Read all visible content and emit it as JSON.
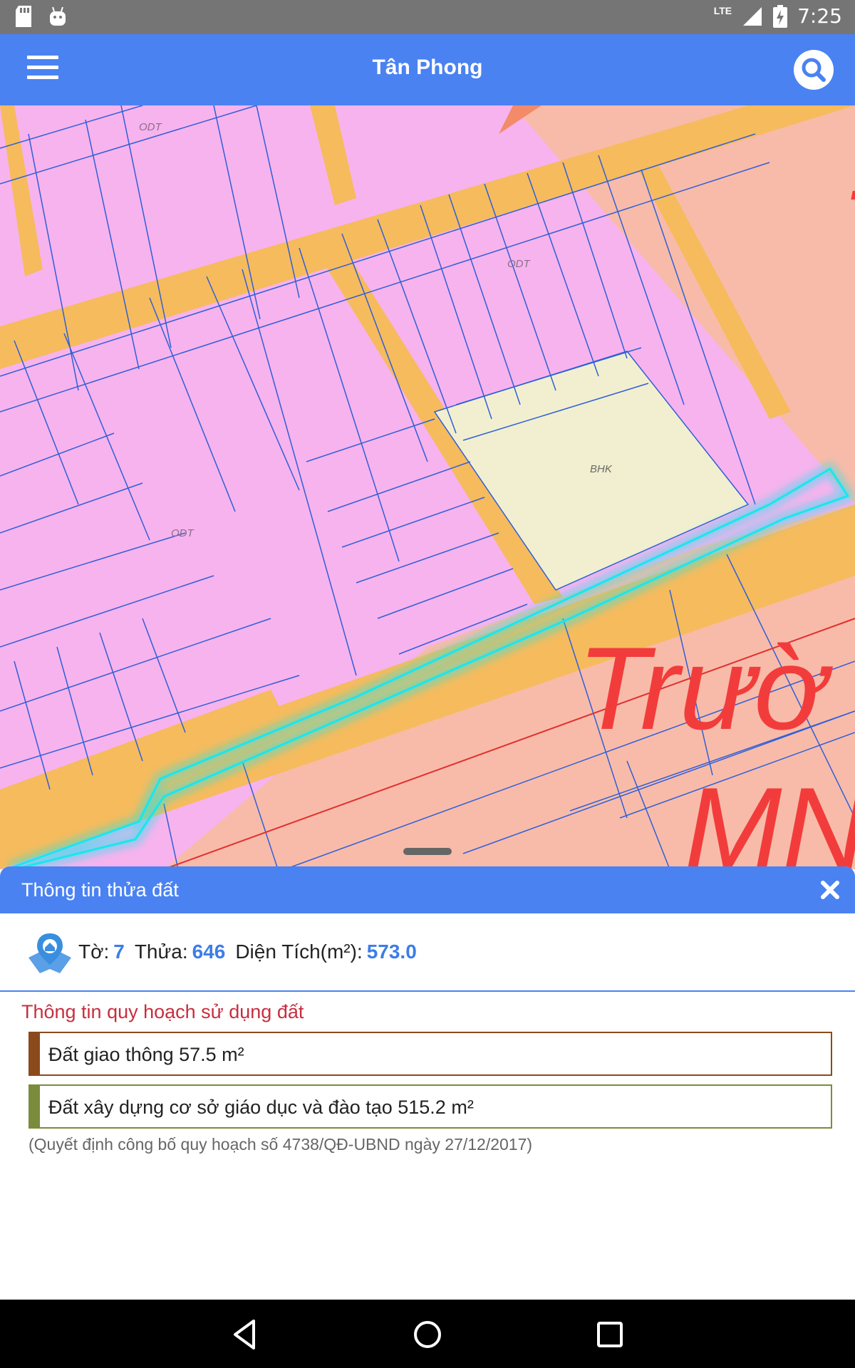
{
  "status_bar": {
    "time": "7:25",
    "network": "LTE",
    "icons": [
      "sd-card-icon",
      "android-debug-icon",
      "signal-icon",
      "battery-charging-icon"
    ]
  },
  "app_bar": {
    "title": "Tân Phong",
    "menu_icon": "hamburger-menu-icon",
    "search_icon": "search-icon",
    "color": "#4a82f2"
  },
  "map": {
    "labels": [
      "ODT",
      "ODT",
      "ODT",
      "BHK"
    ],
    "overlay_text": [
      "Trườ",
      "MN"
    ],
    "colors": {
      "residential": "#f7b3ed",
      "road": "#f6bb5d",
      "school": "#f8bba9",
      "other": "#f2efd0",
      "parcel_border": "#2f5fd8",
      "highlight": "#19e6ef"
    }
  },
  "sheet": {
    "title": "Thông tin thửa đất",
    "close_icon": "close-icon",
    "parcel": {
      "icon": "map-location-icon",
      "to_label": "Tờ:",
      "to_value": "7",
      "thua_label": "Thửa:",
      "thua_value": "646",
      "area_label": "Diện Tích(m²):",
      "area_value": "573.0"
    },
    "plan_heading": "Thông tin quy hoạch sử dụng đất",
    "plan_items": [
      {
        "text": "Đất giao thông 57.5 m²",
        "color": "#8b4a1c"
      },
      {
        "text": "Đất xây dựng cơ sở giáo dục và đào tạo 515.2 m²",
        "color": "#7a8c3c"
      }
    ],
    "note": "(Quyết định công bố quy hoạch số 4738/QĐ-UBND ngày 27/12/2017)"
  },
  "nav_bar": {
    "icons": [
      "back-icon",
      "home-icon",
      "recents-icon"
    ]
  }
}
